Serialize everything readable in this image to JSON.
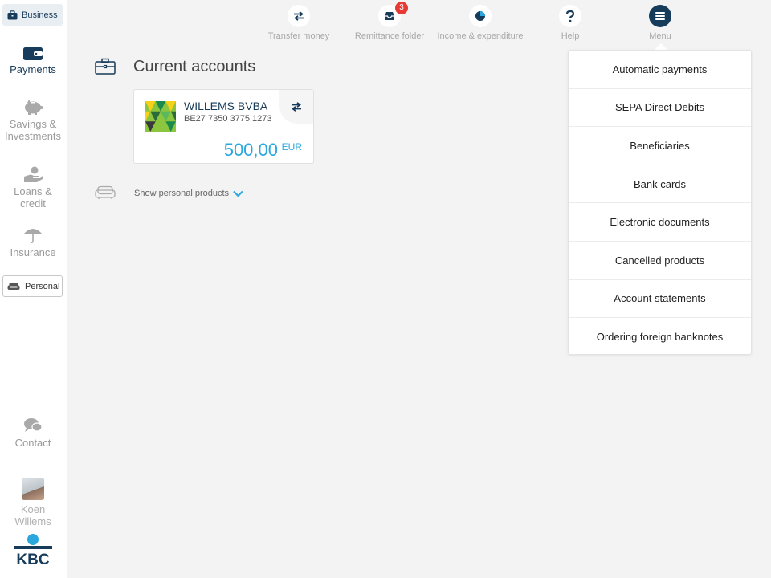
{
  "sidebar": {
    "business_label": "Business",
    "items": [
      {
        "label": "Payments",
        "icon": "wallet-icon",
        "active": true
      },
      {
        "label": "Savings & Investments",
        "icon": "piggy-bank-icon"
      },
      {
        "label": "Loans & credit",
        "icon": "hand-coin-icon"
      },
      {
        "label": "Insurance",
        "icon": "umbrella-icon"
      }
    ],
    "personal_label": "Personal",
    "contact_label": "Contact",
    "user_name": "Koen Willems",
    "logo_text": "KBC"
  },
  "topnav": {
    "items": [
      {
        "label": "Transfer money",
        "icon": "transfer-arrows-icon"
      },
      {
        "label": "Remittance folder",
        "icon": "inbox-tray-icon",
        "badge": "3"
      },
      {
        "label": "Income & expenditure",
        "icon": "pie-chart-icon"
      },
      {
        "label": "Help",
        "icon": "question-icon"
      },
      {
        "label": "Menu",
        "icon": "hamburger-menu-icon"
      }
    ]
  },
  "main": {
    "section_title": "Current accounts",
    "account": {
      "name": "WILLEMS BVBA",
      "iban": "BE27 7350 3775 1273",
      "amount": "500,00",
      "currency": "EUR"
    },
    "show_personal_label": "Show personal products"
  },
  "menu": {
    "items": [
      "Automatic payments",
      "SEPA Direct Debits",
      "Beneficiaries",
      "Bank cards",
      "Electronic documents",
      "Cancelled products",
      "Account statements",
      "Ordering foreign banknotes"
    ]
  },
  "colors": {
    "brand_navy": "#173b5a",
    "accent_blue": "#2aa7dd",
    "badge_red": "#e63a35",
    "background": "#f3f3f3"
  }
}
